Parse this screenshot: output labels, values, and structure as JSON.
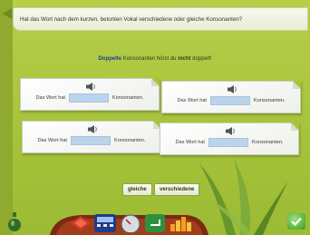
{
  "question": "Hat das Wort nach dem kurzen, betonten Vokal verschiedene oder gleiche Konsonanten?",
  "instruction": {
    "hl": "Doppelte",
    "mid": " Konsonanten hörst du ",
    "bold": "nicht",
    "end": " doppelt!"
  },
  "cards": [
    {
      "prefix": "Das Wort hat",
      "suffix": "Konsonanten.",
      "value": ""
    },
    {
      "prefix": "Das Wort hat",
      "suffix": "Konsonanten.",
      "value": ""
    },
    {
      "prefix": "Das Wort hat",
      "suffix": "Konsonanten.",
      "value": ""
    },
    {
      "prefix": "Das Wort hat",
      "suffix": "Konsonanten.",
      "value": ""
    }
  ],
  "buttons": {
    "gleiche": "gleiche",
    "verschiedene": "verschiedene"
  },
  "toolbar": {
    "icons": [
      "potion-bottle-icon",
      "diamond-icon",
      "calculator-icon",
      "speedometer-icon",
      "return-icon",
      "bar-chart-icon",
      "check-icon"
    ]
  },
  "colors": {
    "background": "#a8c43c",
    "field": "#bcd3ec",
    "check": "#3f9b26"
  }
}
